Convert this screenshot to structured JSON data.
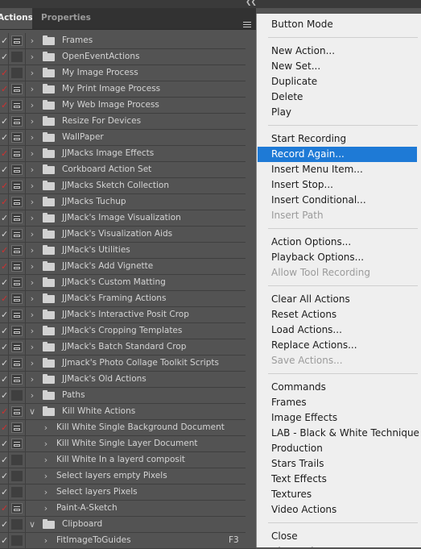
{
  "panel": {
    "collapse_icon": "double-chevron-left",
    "tabs": [
      {
        "label": "Actions",
        "active": true
      },
      {
        "label": "Properties",
        "active": false
      }
    ],
    "menu_icon": "hamburger"
  },
  "actions_list": [
    {
      "label": "Frames",
      "type": "set",
      "check": "white",
      "dialog": true,
      "expanded": false,
      "level": 0
    },
    {
      "label": "OpenEventActions",
      "type": "set",
      "check": "white",
      "dialog": false,
      "expanded": false,
      "level": 0
    },
    {
      "label": "My Image Process",
      "type": "set",
      "check": "red",
      "dialog": false,
      "expanded": false,
      "level": 0
    },
    {
      "label": "My Print Image Process",
      "type": "set",
      "check": "red",
      "dialog": true,
      "expanded": false,
      "level": 0
    },
    {
      "label": "My Web Image Process",
      "type": "set",
      "check": "red",
      "dialog": true,
      "expanded": false,
      "level": 0
    },
    {
      "label": "Resize For Devices",
      "type": "set",
      "check": "white",
      "dialog": true,
      "expanded": false,
      "level": 0
    },
    {
      "label": "WallPaper",
      "type": "set",
      "check": "white",
      "dialog": true,
      "expanded": false,
      "level": 0
    },
    {
      "label": "JJMacks Image Effects",
      "type": "set",
      "check": "red",
      "dialog": true,
      "expanded": false,
      "level": 0
    },
    {
      "label": "Corkboard Action Set",
      "type": "set",
      "check": "white",
      "dialog": true,
      "expanded": false,
      "level": 0
    },
    {
      "label": "JJMacks Sketch Collection",
      "type": "set",
      "check": "red",
      "dialog": true,
      "expanded": false,
      "level": 0
    },
    {
      "label": "JJMacks Tuchup",
      "type": "set",
      "check": "red",
      "dialog": true,
      "expanded": false,
      "level": 0
    },
    {
      "label": "JJMack's Image Visualization",
      "type": "set",
      "check": "white",
      "dialog": true,
      "expanded": false,
      "level": 0
    },
    {
      "label": "JJMack's Visualization Aids",
      "type": "set",
      "check": "white",
      "dialog": true,
      "expanded": false,
      "level": 0
    },
    {
      "label": "JJMack's Utilities",
      "type": "set",
      "check": "red",
      "dialog": true,
      "expanded": false,
      "level": 0
    },
    {
      "label": "JJMack's Add Vignette",
      "type": "set",
      "check": "red",
      "dialog": true,
      "expanded": false,
      "level": 0
    },
    {
      "label": "JJMack's Custom Matting",
      "type": "set",
      "check": "white",
      "dialog": true,
      "expanded": false,
      "level": 0
    },
    {
      "label": "JJMack's Framing Actions",
      "type": "set",
      "check": "red",
      "dialog": true,
      "expanded": false,
      "level": 0
    },
    {
      "label": "JJMack's Interactive Posit Crop",
      "type": "set",
      "check": "white",
      "dialog": true,
      "expanded": false,
      "level": 0
    },
    {
      "label": "JJMack's Cropping Templates",
      "type": "set",
      "check": "white",
      "dialog": true,
      "expanded": false,
      "level": 0
    },
    {
      "label": "JJMack's Batch Standard Crop",
      "type": "set",
      "check": "white",
      "dialog": true,
      "expanded": false,
      "level": 0
    },
    {
      "label": "JJmack's Photo Collage Toolkit Scripts",
      "type": "set",
      "check": "white",
      "dialog": true,
      "expanded": false,
      "level": 0
    },
    {
      "label": "JJMack's Old Actions",
      "type": "set",
      "check": "white",
      "dialog": true,
      "expanded": false,
      "level": 0
    },
    {
      "label": "Paths",
      "type": "set",
      "check": "white",
      "dialog": false,
      "expanded": false,
      "level": 0
    },
    {
      "label": "Kill White Actions",
      "type": "set",
      "check": "red",
      "dialog": true,
      "expanded": true,
      "level": 0
    },
    {
      "label": "Kill White Single Background Document",
      "type": "action",
      "check": "red",
      "dialog": true,
      "expanded": false,
      "level": 1
    },
    {
      "label": "Kill White Single Layer Document",
      "type": "action",
      "check": "white",
      "dialog": true,
      "expanded": false,
      "level": 1
    },
    {
      "label": "Kill White In a layerd composit",
      "type": "action",
      "check": "white",
      "dialog": false,
      "expanded": false,
      "level": 1
    },
    {
      "label": "Select layers empty Pixels",
      "type": "action",
      "check": "white",
      "dialog": false,
      "expanded": false,
      "level": 1
    },
    {
      "label": "Select layers  Pixels",
      "type": "action",
      "check": "white",
      "dialog": false,
      "expanded": false,
      "level": 1
    },
    {
      "label": "Paint-A-Sketch",
      "type": "action",
      "check": "red",
      "dialog": true,
      "expanded": false,
      "level": 1
    },
    {
      "label": "Clipboard",
      "type": "set",
      "check": "white",
      "dialog": false,
      "expanded": true,
      "level": 0
    },
    {
      "label": "FitImageToGuides",
      "type": "action",
      "check": "white",
      "dialog": false,
      "expanded": false,
      "level": 1,
      "shortcut": "F3"
    }
  ],
  "context_menu": [
    {
      "label": "Button Mode",
      "state": "normal"
    },
    {
      "sep": true
    },
    {
      "label": "New Action...",
      "state": "normal"
    },
    {
      "label": "New Set...",
      "state": "normal"
    },
    {
      "label": "Duplicate",
      "state": "normal"
    },
    {
      "label": "Delete",
      "state": "normal"
    },
    {
      "label": "Play",
      "state": "normal"
    },
    {
      "sep": true
    },
    {
      "label": "Start Recording",
      "state": "normal"
    },
    {
      "label": "Record Again...",
      "state": "highlighted"
    },
    {
      "label": "Insert Menu Item...",
      "state": "normal"
    },
    {
      "label": "Insert Stop...",
      "state": "normal"
    },
    {
      "label": "Insert Conditional...",
      "state": "normal"
    },
    {
      "label": "Insert Path",
      "state": "disabled"
    },
    {
      "sep": true
    },
    {
      "label": "Action Options...",
      "state": "normal"
    },
    {
      "label": "Playback Options...",
      "state": "normal"
    },
    {
      "label": "Allow Tool Recording",
      "state": "disabled"
    },
    {
      "sep": true
    },
    {
      "label": "Clear All Actions",
      "state": "normal"
    },
    {
      "label": "Reset Actions",
      "state": "normal"
    },
    {
      "label": "Load Actions...",
      "state": "normal"
    },
    {
      "label": "Replace Actions...",
      "state": "normal"
    },
    {
      "label": "Save Actions...",
      "state": "disabled"
    },
    {
      "sep": true
    },
    {
      "label": "Commands",
      "state": "normal"
    },
    {
      "label": "Frames",
      "state": "normal"
    },
    {
      "label": "Image Effects",
      "state": "normal"
    },
    {
      "label": "LAB - Black & White Technique",
      "state": "normal"
    },
    {
      "label": "Production",
      "state": "normal"
    },
    {
      "label": "Stars Trails",
      "state": "normal"
    },
    {
      "label": "Text Effects",
      "state": "normal"
    },
    {
      "label": "Textures",
      "state": "normal"
    },
    {
      "label": "Video Actions",
      "state": "normal"
    },
    {
      "sep": true
    },
    {
      "label": "Close",
      "state": "normal"
    },
    {
      "label": "Close Tab Group",
      "state": "normal"
    }
  ],
  "colors": {
    "panel_bg": "#535353",
    "tab_bar_bg": "#323232",
    "menu_bg": "#efefef",
    "highlight": "#1e7ad6",
    "check_red": "#d03030",
    "disabled_text": "#9b9b9b"
  }
}
